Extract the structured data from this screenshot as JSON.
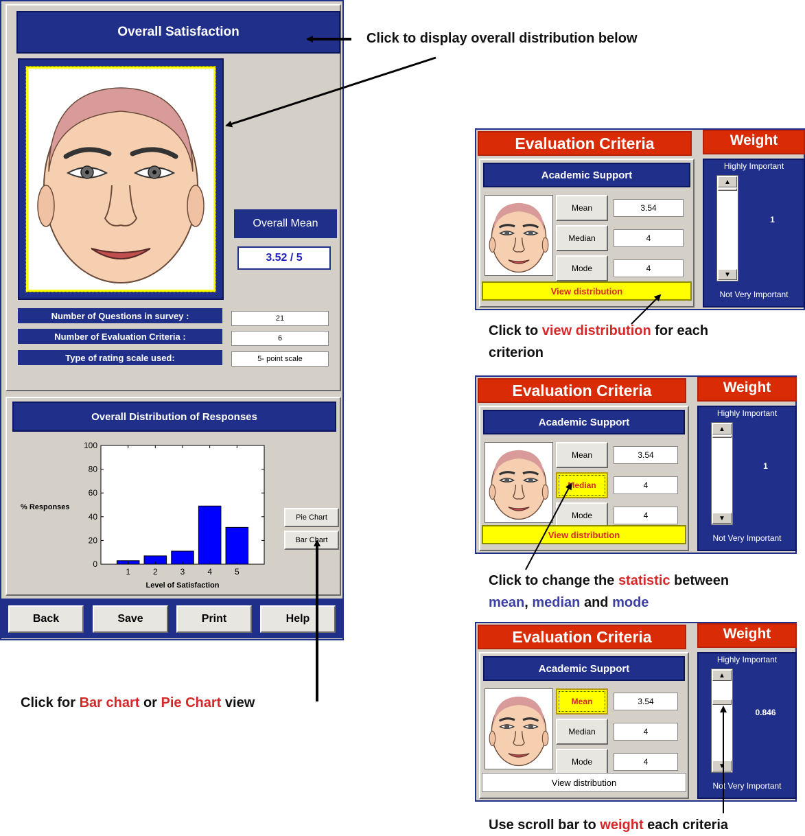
{
  "main": {
    "title": "Overall Satisfaction",
    "overall_mean_label": "Overall Mean",
    "overall_mean_value": "3.52 / 5",
    "info_rows": [
      {
        "label": "Number of Questions in survey :",
        "value": "21"
      },
      {
        "label": "Number of Evaluation Criteria :",
        "value": "6"
      },
      {
        "label": "Type of rating scale used:",
        "value": "5- point scale"
      }
    ],
    "distribution_title": "Overall Distribution of Responses",
    "pie_chart_button": "Pie Chart",
    "bar_chart_button": "Bar Chart",
    "footer_buttons": [
      "Back",
      "Save",
      "Print",
      "Help"
    ]
  },
  "chart_data": {
    "type": "bar",
    "categories": [
      "1",
      "2",
      "3",
      "4",
      "5"
    ],
    "values": [
      3,
      7,
      11,
      49,
      31
    ],
    "xlabel": "Level of Satisfaction",
    "ylabel": "% Responses",
    "ylim": [
      0,
      100
    ],
    "yticks": [
      "0",
      "20",
      "40",
      "60",
      "80",
      "100"
    ],
    "bar_color": "#0000ff",
    "grid": false
  },
  "criteria_panels": [
    {
      "title": "Evaluation Criteria",
      "weight_title": "Weight",
      "criterion": "Academic Support",
      "stats": [
        {
          "label": "Mean",
          "value": "3.54"
        },
        {
          "label": "Median",
          "value": "4"
        },
        {
          "label": "Mode",
          "value": "4"
        }
      ],
      "view_label": "View distribution",
      "highly_important": "Highly Important",
      "not_very_important": "Not Very Important",
      "weight_value": "1"
    },
    {
      "title": "Evaluation Criteria",
      "weight_title": "Weight",
      "criterion": "Academic Support",
      "stats": [
        {
          "label": "Mean",
          "value": "3.54"
        },
        {
          "label": "Median",
          "value": "4"
        },
        {
          "label": "Mode",
          "value": "4"
        }
      ],
      "view_label": "View distribution",
      "highly_important": "Highly Important",
      "not_very_important": "Not Very Important",
      "weight_value": "1"
    },
    {
      "title": "Evaluation Criteria",
      "weight_title": "Weight",
      "criterion": "Academic Support",
      "stats": [
        {
          "label": "Mean",
          "value": "3.54"
        },
        {
          "label": "Median",
          "value": "4"
        },
        {
          "label": "Mode",
          "value": "4"
        }
      ],
      "view_label": "View distribution",
      "highly_important": "Highly Important",
      "not_very_important": "Not Very Important",
      "weight_value": "0.846"
    }
  ],
  "annotations": {
    "a1": "Click to display overall distribution below",
    "a2_pre": "Click to ",
    "a2_red": "view distribution",
    "a2_post": " for each",
    "a2_line2": "criterion",
    "a3_pre": "Click to change the ",
    "a3_red": "statistic",
    "a3_post": " between",
    "a3_mean": "mean",
    "a3_sep1": ", ",
    "a3_median": "median",
    "a3_and": " and ",
    "a3_mode": "mode",
    "a4_pre": "Click for ",
    "a4_bar": "Bar chart",
    "a4_or": " or ",
    "a4_pie": "Pie Chart",
    "a4_post": " view",
    "a5_pre": "Use scroll bar to ",
    "a5_red": "weight",
    "a5_post": " each criteria"
  },
  "colors": {
    "navy": "#1f2f8a",
    "red_header": "#d92b06",
    "highlight_yellow": "#ffff00",
    "window_grey": "#d4d0c8",
    "annotation_red": "#d62828",
    "annotation_blue": "#3b3fa5"
  }
}
